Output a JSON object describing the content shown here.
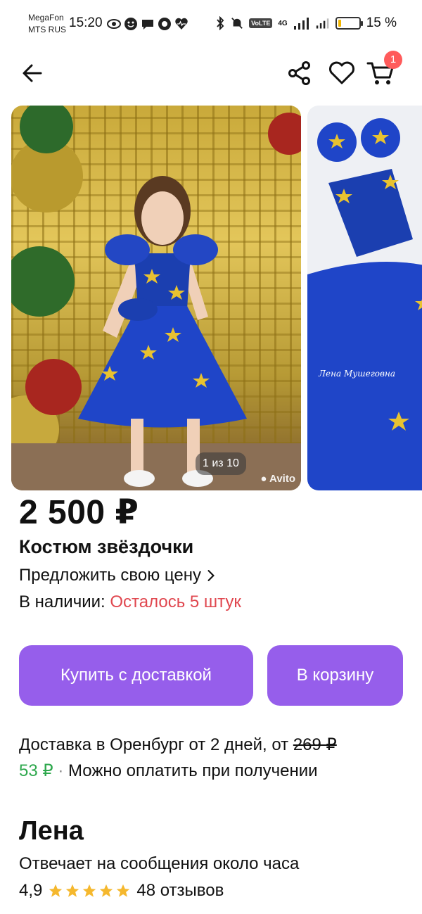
{
  "status_bar": {
    "carrier1": "MegaFon",
    "carrier2": "MTS RUS",
    "time": "15:20",
    "network": "4G",
    "volte": "VoLTE",
    "battery": "15 %",
    "battery_level": 0.15,
    "battery_color": "#f2b600"
  },
  "app_bar": {
    "cart_badge": "1"
  },
  "gallery": {
    "counter": "1 из 10",
    "watermark": "Avito",
    "second_caption": "Лена Мушеговна"
  },
  "product": {
    "price": "2 500 ₽",
    "title": "Костюм звёздочки",
    "offer_price_link": "Предложить свою цену",
    "availability_label": "В наличии:",
    "availability_value": "Осталось 5 штук"
  },
  "actions": {
    "buy_label": "Купить с доставкой",
    "cart_label": "В корзину",
    "accent_color": "#965eeb"
  },
  "delivery": {
    "text": "Доставка в Оренбург от 2 дней, от",
    "old_price": "269 ₽",
    "new_price": "53 ₽",
    "separator": "·",
    "payment_note": "Можно оплатить при получении"
  },
  "seller": {
    "name": "Лена",
    "reply_time": "Отвечает на сообщения около часа",
    "rating": "4,9",
    "rating_stars": 5,
    "reviews": "48 отзывов"
  }
}
